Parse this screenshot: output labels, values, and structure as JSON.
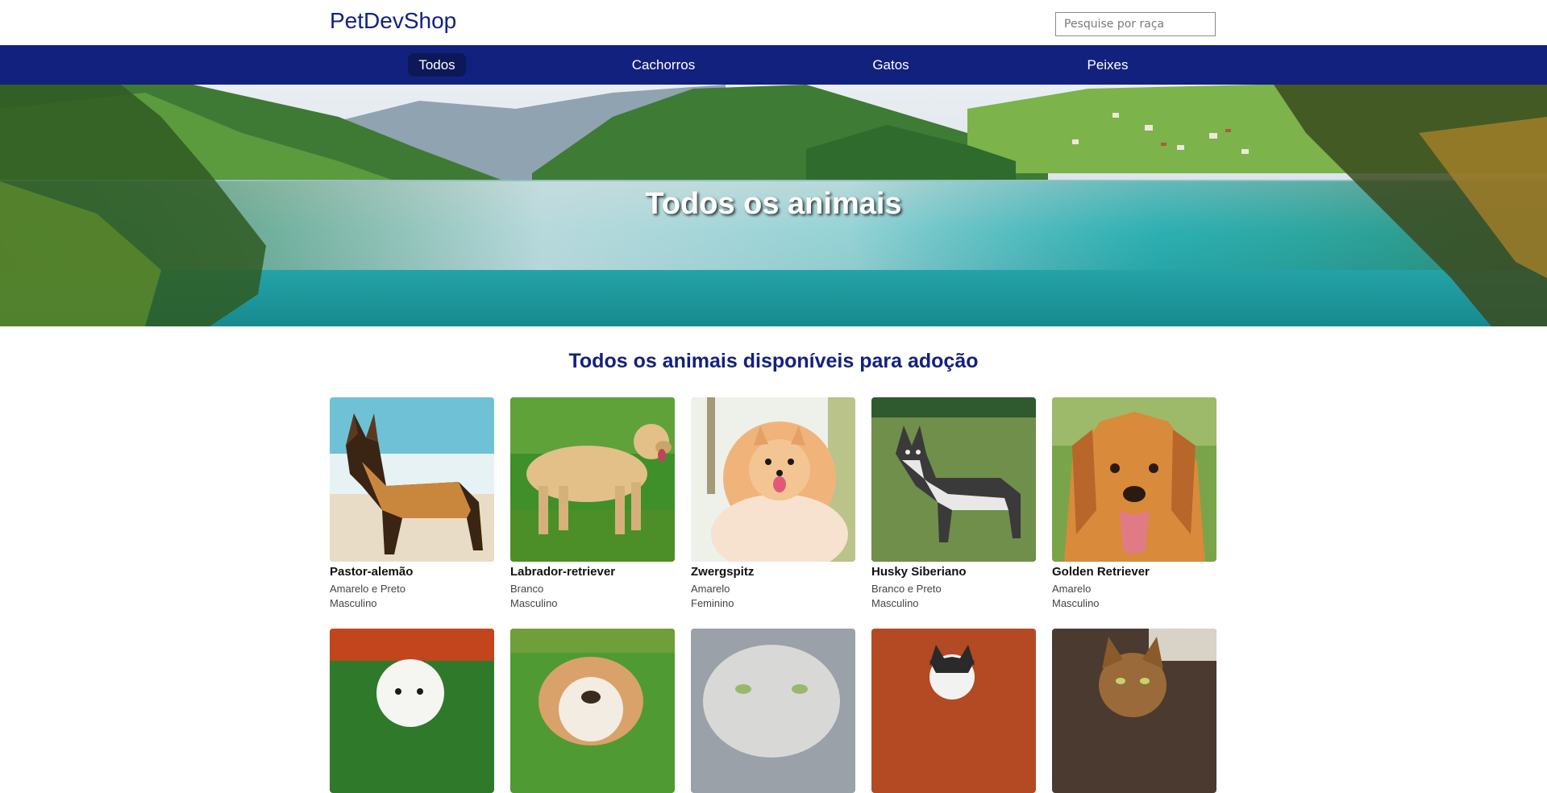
{
  "header": {
    "logo": "PetDevShop",
    "search_placeholder": "Pesquise por raça"
  },
  "nav": {
    "items": [
      {
        "label": "Todos",
        "active": true
      },
      {
        "label": "Cachorros",
        "active": false
      },
      {
        "label": "Gatos",
        "active": false
      },
      {
        "label": "Peixes",
        "active": false
      }
    ]
  },
  "hero": {
    "title": "Todos os animais"
  },
  "section": {
    "title": "Todos os animais disponíveis para adoção"
  },
  "pets": [
    {
      "name": "Pastor-alemão",
      "color": "Amarelo e Preto",
      "sex": "Masculino"
    },
    {
      "name": "Labrador-retriever",
      "color": "Branco",
      "sex": "Masculino"
    },
    {
      "name": "Zwergspitz",
      "color": "Amarelo",
      "sex": "Feminino"
    },
    {
      "name": "Husky Siberiano",
      "color": "Branco e Preto",
      "sex": "Masculino"
    },
    {
      "name": "Golden Retriever",
      "color": "Amarelo",
      "sex": "Masculino"
    }
  ],
  "colors": {
    "brand": "#13217e",
    "nav_active": "#0d1858"
  }
}
